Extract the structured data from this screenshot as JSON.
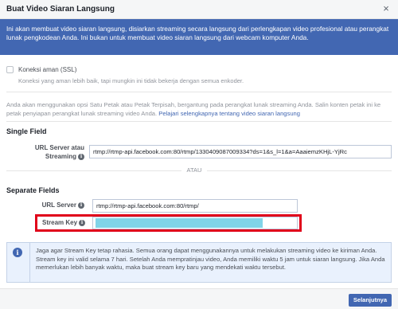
{
  "dialog": {
    "title": "Buat Video Siaran Langsung",
    "close_glyph": "×"
  },
  "banner": {
    "text": "Ini akan membuat video siaran langsung, disiarkan streaming secara langsung dari perlengkapan video profesional atau perangkat lunak pengkodean Anda. Ini bukan untuk membuat video siaran langsung dari webcam komputer Anda."
  },
  "ssl": {
    "label": "Koneksi aman (SSL)",
    "checked": false,
    "description": "Koneksi yang aman lebih baik, tapi mungkin ini tidak bekerja dengan semua enkoder."
  },
  "description": {
    "text": "Anda akan menggunakan opsi Satu Petak atau Petak Terpisah, bergantung pada perangkat lunak streaming Anda. Salin konten petak ini ke petak penyiapan perangkat lunak streaming video Anda.",
    "link": "Pelajari selengkapnya tentang video siaran langsung"
  },
  "single_field": {
    "title": "Single Field",
    "label_line1": "URL Server atau",
    "label_line2": "Streaming",
    "value": "rtmp://rtmp-api.facebook.com:80/rtmp/1330409087009334?ds=1&s_l=1&a=AaaiemzKHjL-YjRc"
  },
  "separator": {
    "label": "ATAU"
  },
  "separate_fields": {
    "title": "Separate Fields",
    "url_label": "URL Server",
    "url_value": "rtmp://rtmp-api.facebook.com:80/rtmp/",
    "stream_key_label": "Stream Key"
  },
  "notice": {
    "icon": "info-icon",
    "text": "Jaga agar Stream Key tetap rahasia. Semua orang dapat menggunakannya untuk melakukan streaming video ke kiriman Anda. Stream key ini valid selama 7 hari. Setelah Anda mempratinjau video, Anda memiliki waktu 5 jam untuk siaran langsung. Jika Anda memerlukan lebih banyak waktu, maka buat stream key baru yang mendekati waktu tersebut."
  },
  "footer": {
    "next_label": "Selanjutnya"
  },
  "colors": {
    "brand": "#4267b2",
    "highlight": "#e0001a",
    "masked_key": "#80d4e8"
  }
}
